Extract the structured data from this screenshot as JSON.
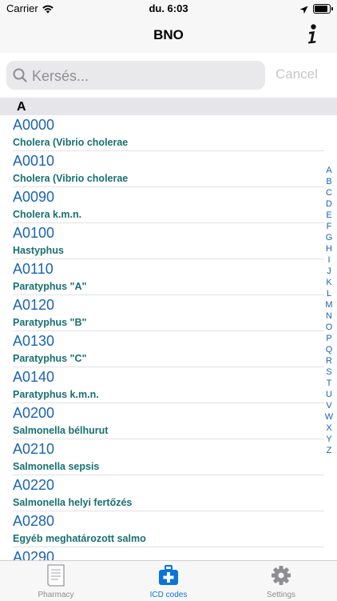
{
  "status_bar": {
    "carrier": "Carrier",
    "time": "du. 6:03"
  },
  "nav": {
    "title": "BNO"
  },
  "search": {
    "placeholder": "Kersés...",
    "cancel_label": "Cancel"
  },
  "section": {
    "title": "A"
  },
  "rows": [
    {
      "code": "A0000",
      "desc": "Cholera (Vibrio cholerae"
    },
    {
      "code": "A0010",
      "desc": "Cholera (Vibrio cholerae"
    },
    {
      "code": "A0090",
      "desc": "Cholera k.m.n."
    },
    {
      "code": "A0100",
      "desc": "Hastyphus"
    },
    {
      "code": "A0110",
      "desc": "Paratyphus \"A\""
    },
    {
      "code": "A0120",
      "desc": "Paratyphus \"B\""
    },
    {
      "code": "A0130",
      "desc": "Paratyphus \"C\""
    },
    {
      "code": "A0140",
      "desc": "Paratyphus k.m.n."
    },
    {
      "code": "A0200",
      "desc": "Salmonella bélhurut"
    },
    {
      "code": "A0210",
      "desc": "Salmonella sepsis"
    },
    {
      "code": "A0220",
      "desc": "Salmonella helyi fertőzés"
    },
    {
      "code": "A0280",
      "desc": "Egyéb meghatározott salmo"
    },
    {
      "code": "A0290",
      "desc": ""
    }
  ],
  "index_letters": [
    "A",
    "B",
    "C",
    "D",
    "E",
    "F",
    "G",
    "H",
    "I",
    "J",
    "K",
    "L",
    "M",
    "N",
    "O",
    "P",
    "Q",
    "R",
    "S",
    "T",
    "U",
    "V",
    "W",
    "X",
    "Y",
    "Z"
  ],
  "tabs": [
    {
      "label": "Pharmacy",
      "icon": "document-icon",
      "active": false
    },
    {
      "label": "ICD codes",
      "icon": "first-aid-kit-icon",
      "active": true
    },
    {
      "label": "Settings",
      "icon": "gear-icon",
      "active": false
    }
  ],
  "colors": {
    "accent": "#0a74d9",
    "code_text": "#1a63b3",
    "desc_text": "#187070",
    "inactive_tab": "#8e8e93"
  }
}
